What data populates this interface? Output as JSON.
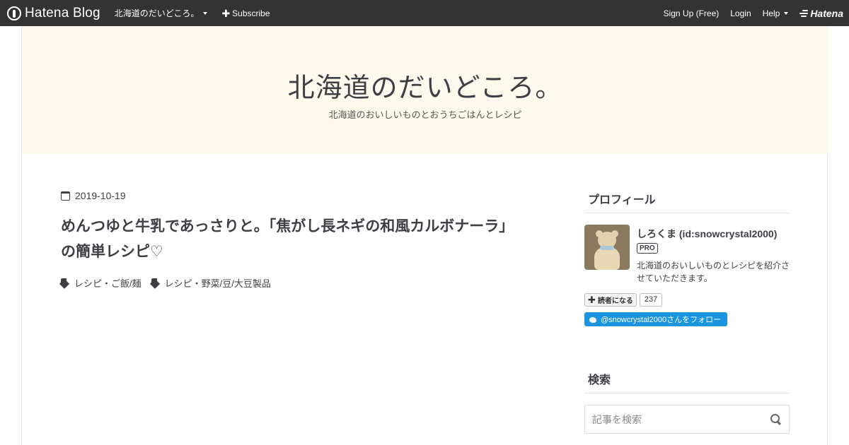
{
  "navbar": {
    "brand": "Hatena Blog",
    "blog_switch": "北海道のだいどころ。",
    "subscribe": "Subscribe",
    "signup": "Sign Up (Free)",
    "login": "Login",
    "help": "Help",
    "hatena_logo": "Hatena"
  },
  "header": {
    "title": "北海道のだいどころ。",
    "description": "北海道のおいしいものとおうちごはんとレシピ"
  },
  "entry": {
    "date": "2019-10-19",
    "title": "めんつゆと牛乳であっさりと。「焦がし長ネギの和風カルボナーラ」の簡単レシピ♡",
    "categories": [
      "レシピ・ご飯/麺",
      "レシピ・野菜/豆/大豆製品"
    ]
  },
  "sidebar": {
    "profile": {
      "heading": "プロフィール",
      "name": "しろくま (id:snowcrystal2000)",
      "badge": "PRO",
      "description": "北海道のおいしいものとレシピを紹介させていただきます。",
      "subscribe_label": "読者になる",
      "subscriber_count": "237",
      "twitter_follow": "@snowcrystal2000さんをフォロー"
    },
    "search": {
      "heading": "検索",
      "placeholder": "記事を検索"
    }
  },
  "colors": {
    "navbar_bg": "#333333",
    "header_bg": "#fdf9ec",
    "twitter_blue": "#1b95e0",
    "text": "#3d3f44"
  }
}
